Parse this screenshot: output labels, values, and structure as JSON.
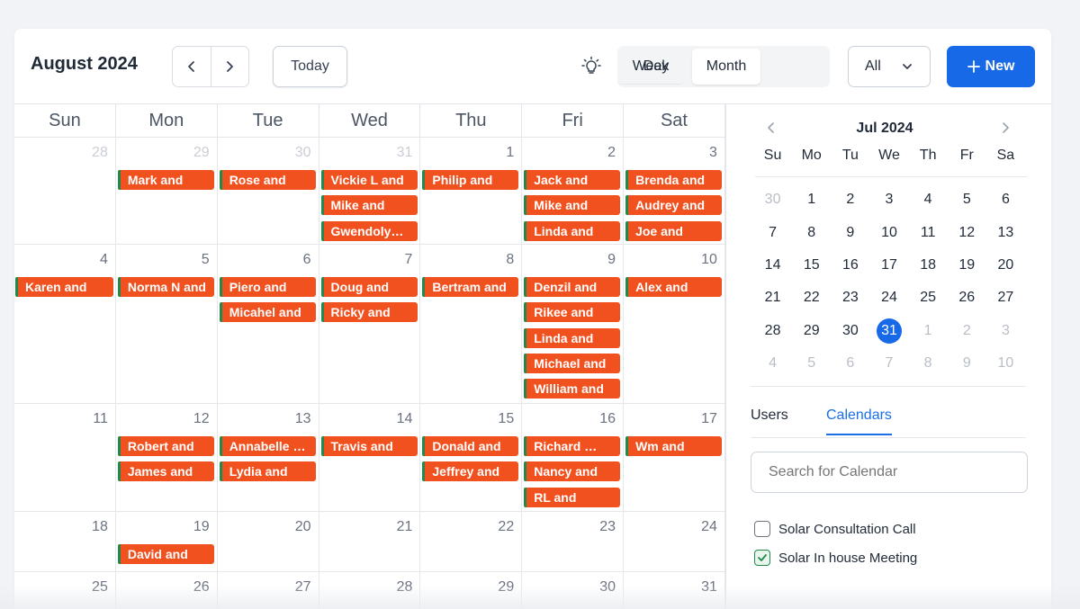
{
  "header": {
    "month_title": "August 2024",
    "today_label": "Today",
    "views": {
      "day": "Day",
      "week": "Week",
      "month": "Month",
      "selected": "Month"
    },
    "filter_value": "All",
    "new_label": "New"
  },
  "grid": {
    "weekdays": [
      "Sun",
      "Mon",
      "Tue",
      "Wed",
      "Thu",
      "Fri",
      "Sat"
    ],
    "weeks": [
      {
        "days": [
          {
            "num": "28",
            "muted": true,
            "events": []
          },
          {
            "num": "29",
            "muted": true,
            "events": [
              "Mark and"
            ]
          },
          {
            "num": "30",
            "muted": true,
            "events": [
              "Rose and"
            ]
          },
          {
            "num": "31",
            "muted": true,
            "events": [
              "Vickie L and",
              "Mike and",
              "Gwendoly…"
            ]
          },
          {
            "num": "1",
            "muted": false,
            "events": [
              "Philip and"
            ]
          },
          {
            "num": "2",
            "muted": false,
            "events": [
              "Jack and",
              "Mike and",
              "Linda and"
            ]
          },
          {
            "num": "3",
            "muted": false,
            "events": [
              "Brenda and",
              "Audrey and",
              "Joe and"
            ]
          }
        ]
      },
      {
        "days": [
          {
            "num": "4",
            "muted": false,
            "events": [
              "Karen and"
            ]
          },
          {
            "num": "5",
            "muted": false,
            "events": [
              "Norma N and"
            ]
          },
          {
            "num": "6",
            "muted": false,
            "events": [
              "Piero and",
              "Micahel and"
            ]
          },
          {
            "num": "7",
            "muted": false,
            "events": [
              "Doug and",
              "Ricky  and"
            ]
          },
          {
            "num": "8",
            "muted": false,
            "events": [
              "Bertram and"
            ]
          },
          {
            "num": "9",
            "muted": false,
            "events": [
              "Denzil and",
              "Rikee and",
              "Linda and",
              "Michael and",
              "William and"
            ]
          },
          {
            "num": "10",
            "muted": false,
            "events": [
              "Alex and"
            ]
          }
        ]
      },
      {
        "days": [
          {
            "num": "11",
            "muted": false,
            "events": []
          },
          {
            "num": "12",
            "muted": false,
            "events": [
              "Robert and",
              "James and"
            ]
          },
          {
            "num": "13",
            "muted": false,
            "events": [
              "Annabelle …",
              "Lydia and"
            ]
          },
          {
            "num": "14",
            "muted": false,
            "events": [
              "Travis and"
            ]
          },
          {
            "num": "15",
            "muted": false,
            "events": [
              "Donald and",
              "Jeffrey and"
            ]
          },
          {
            "num": "16",
            "muted": false,
            "events": [
              "Richard …",
              "Nancy and",
              "RL and"
            ]
          },
          {
            "num": "17",
            "muted": false,
            "events": [
              "Wm and"
            ]
          }
        ]
      },
      {
        "days": [
          {
            "num": "18",
            "muted": false,
            "events": []
          },
          {
            "num": "19",
            "muted": false,
            "events": [
              "David and"
            ]
          },
          {
            "num": "20",
            "muted": false,
            "events": []
          },
          {
            "num": "21",
            "muted": false,
            "events": []
          },
          {
            "num": "22",
            "muted": false,
            "events": []
          },
          {
            "num": "23",
            "muted": false,
            "events": []
          },
          {
            "num": "24",
            "muted": false,
            "events": []
          }
        ]
      },
      {
        "days": [
          {
            "num": "25",
            "muted": false,
            "events": []
          },
          {
            "num": "26",
            "muted": false,
            "events": []
          },
          {
            "num": "27",
            "muted": false,
            "events": []
          },
          {
            "num": "28",
            "muted": false,
            "events": []
          },
          {
            "num": "29",
            "muted": false,
            "events": []
          },
          {
            "num": "30",
            "muted": false,
            "events": []
          },
          {
            "num": "31",
            "muted": false,
            "events": []
          }
        ]
      }
    ]
  },
  "mini_calendar": {
    "title": "Jul 2024",
    "weekdays": [
      "Su",
      "Mo",
      "Tu",
      "We",
      "Th",
      "Fr",
      "Sa"
    ],
    "selected": "31",
    "rows": [
      [
        {
          "d": "30",
          "m": true
        },
        {
          "d": "1"
        },
        {
          "d": "2"
        },
        {
          "d": "3"
        },
        {
          "d": "4"
        },
        {
          "d": "5"
        },
        {
          "d": "6"
        }
      ],
      [
        {
          "d": "7"
        },
        {
          "d": "8"
        },
        {
          "d": "9"
        },
        {
          "d": "10"
        },
        {
          "d": "11"
        },
        {
          "d": "12"
        },
        {
          "d": "13"
        }
      ],
      [
        {
          "d": "14"
        },
        {
          "d": "15"
        },
        {
          "d": "16"
        },
        {
          "d": "17"
        },
        {
          "d": "18"
        },
        {
          "d": "19"
        },
        {
          "d": "20"
        }
      ],
      [
        {
          "d": "21"
        },
        {
          "d": "22"
        },
        {
          "d": "23"
        },
        {
          "d": "24"
        },
        {
          "d": "25"
        },
        {
          "d": "26"
        },
        {
          "d": "27"
        }
      ],
      [
        {
          "d": "28"
        },
        {
          "d": "29"
        },
        {
          "d": "30"
        },
        {
          "d": "31",
          "sel": true
        },
        {
          "d": "1",
          "m": true
        },
        {
          "d": "2",
          "m": true
        },
        {
          "d": "3",
          "m": true
        }
      ],
      [
        {
          "d": "4",
          "m": true
        },
        {
          "d": "5",
          "m": true
        },
        {
          "d": "6",
          "m": true
        },
        {
          "d": "7",
          "m": true
        },
        {
          "d": "8",
          "m": true
        },
        {
          "d": "9",
          "m": true
        },
        {
          "d": "10",
          "m": true
        }
      ]
    ]
  },
  "side_tabs": {
    "users": "Users",
    "calendars": "Calendars",
    "active": "Calendars"
  },
  "search": {
    "placeholder": "Search for Calendar",
    "value": ""
  },
  "calendar_filters": [
    {
      "label": "Solar Consultation Call",
      "checked": false
    },
    {
      "label": "Solar In house Meeting",
      "checked": true
    }
  ],
  "colors": {
    "accent": "#1769e8",
    "event_bg": "#f1511f",
    "event_stripe": "#1f8a4b"
  },
  "icons": {
    "prev": "chevron-left-icon",
    "next": "chevron-right-icon",
    "theme": "lightbulb-icon",
    "dropdown": "chevron-down-icon",
    "new": "plus-icon",
    "checkbox_checked": "check-icon"
  }
}
